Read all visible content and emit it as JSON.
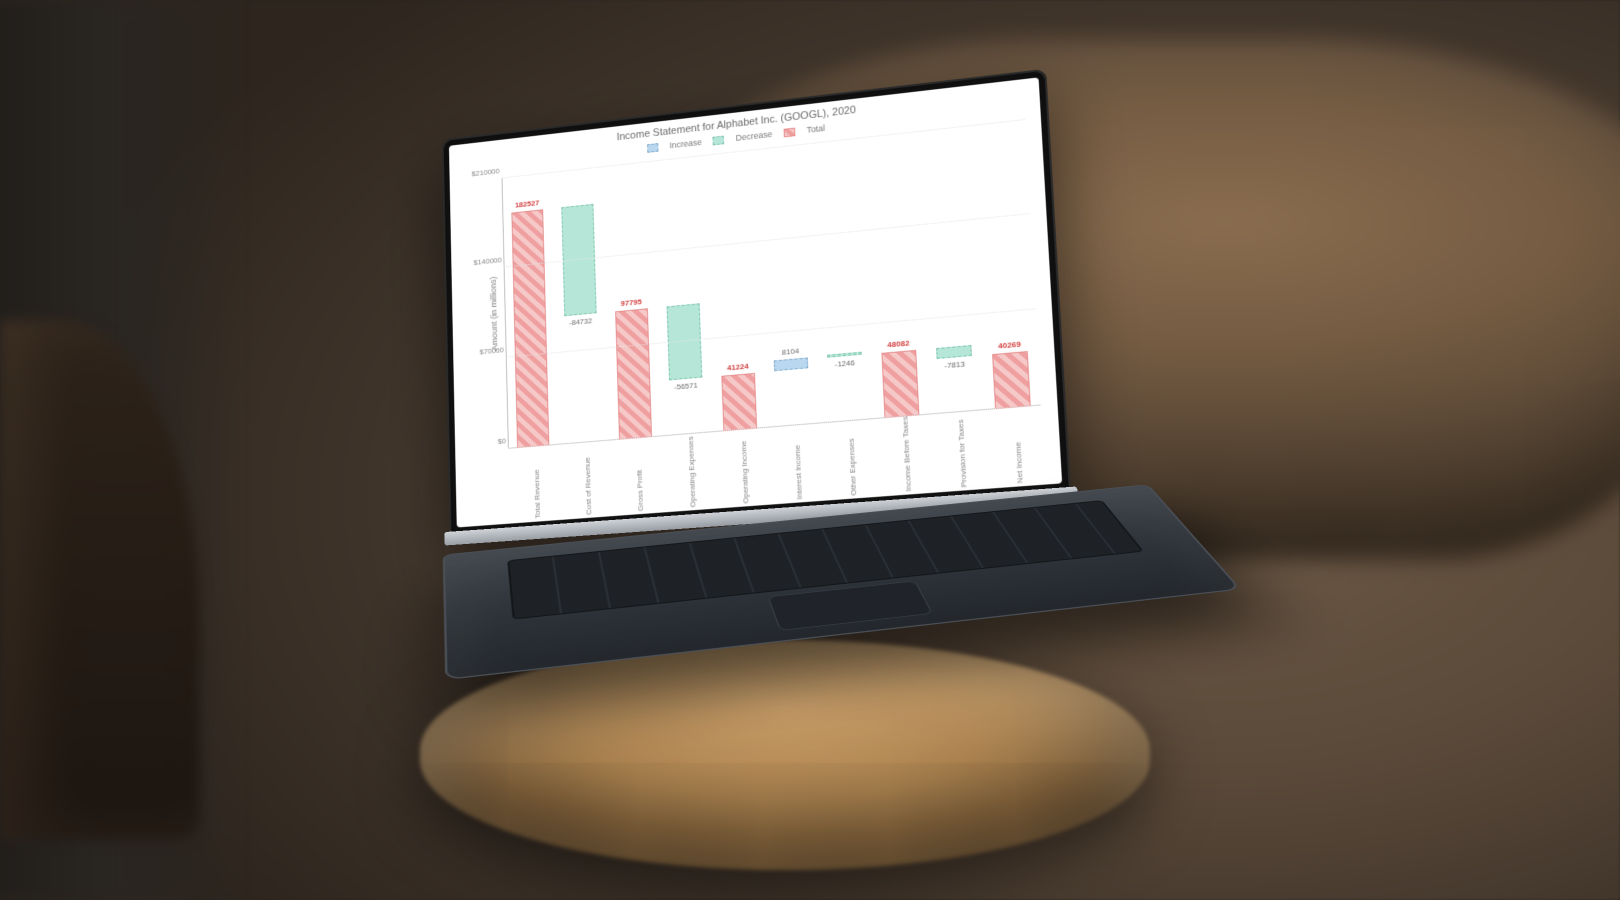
{
  "scene": {
    "setting": "laptop on wooden stool in front of a leather couch"
  },
  "chart_data": {
    "type": "bar",
    "subtype": "waterfall",
    "title": "Income Statement for Alphabet Inc. (GOOGL), 2020",
    "ylabel": "Amount (in millions)",
    "ylim": [
      0,
      210000
    ],
    "yticks": [
      0,
      70000,
      140000,
      210000
    ],
    "ytick_labels": [
      "$0",
      "$70000",
      "$140000",
      "$210000"
    ],
    "legend": [
      "Increase",
      "Decrease",
      "Total"
    ],
    "categories": [
      "Total Revenue",
      "Cost of Revenue",
      "Gross Profit",
      "Operating Expenses",
      "Operating Income",
      "Interest Income",
      "Other Expenses",
      "Income Before Taxes",
      "Provision for Taxes",
      "Net Income"
    ],
    "steps": [
      {
        "name": "Total Revenue",
        "kind": "total",
        "value": 182527,
        "label": "182527"
      },
      {
        "name": "Cost of Revenue",
        "kind": "decrease",
        "value": -84732,
        "label": "-84732"
      },
      {
        "name": "Gross Profit",
        "kind": "total",
        "value": 97795,
        "label": "97795"
      },
      {
        "name": "Operating Expenses",
        "kind": "decrease",
        "value": -56571,
        "label": "-56571"
      },
      {
        "name": "Operating Income",
        "kind": "total",
        "value": 41224,
        "label": "41224"
      },
      {
        "name": "Interest Income",
        "kind": "increase",
        "value": 8104,
        "label": "8104"
      },
      {
        "name": "Other Expenses",
        "kind": "decrease",
        "value": -1246,
        "label": "-1246"
      },
      {
        "name": "Income Before Taxes",
        "kind": "total",
        "value": 48082,
        "label": "48082"
      },
      {
        "name": "Provision for Taxes",
        "kind": "decrease",
        "value": -7813,
        "label": "-7813"
      },
      {
        "name": "Net Income",
        "kind": "total",
        "value": 40269,
        "label": "40269"
      }
    ],
    "colors": {
      "increase": "#b9d8ef",
      "decrease": "#b6e6d7",
      "total": "#ef9f9f"
    }
  }
}
